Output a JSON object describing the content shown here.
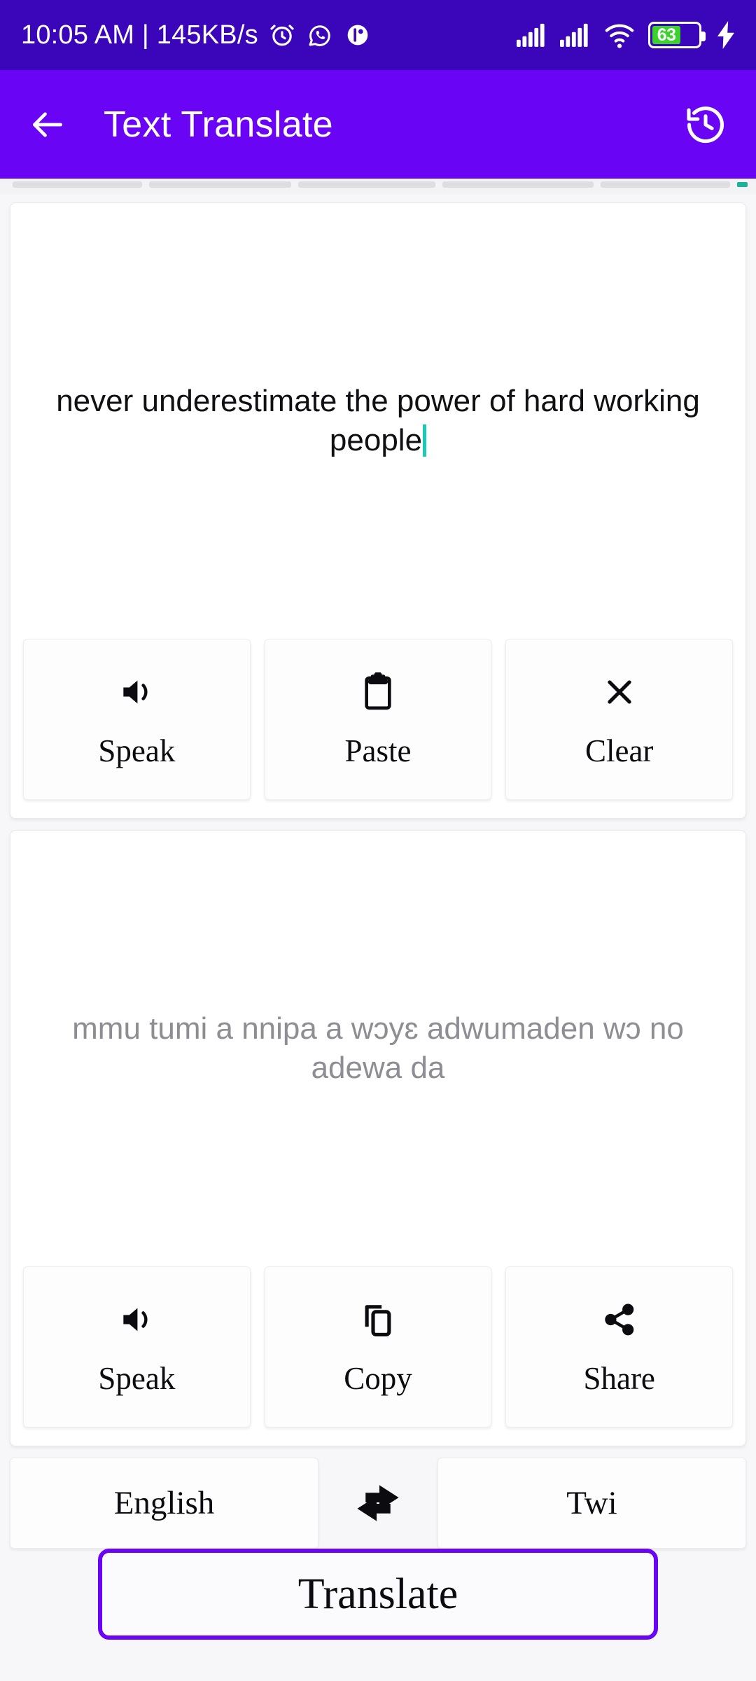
{
  "status_bar": {
    "time": "10:05 AM",
    "separator": "|",
    "network_speed": "145KB/s",
    "battery_level": "63",
    "icons_left": [
      "alarm-icon",
      "whatsapp-icon",
      "app-icon"
    ],
    "icons_right": [
      "signal-1-icon",
      "signal-2-icon",
      "wifi-icon",
      "battery-icon",
      "charging-bolt-icon"
    ],
    "background_color": "#3b06b9",
    "battery_fill_color": "#3ad22b"
  },
  "app_bar": {
    "back_icon": "arrow-left-icon",
    "title": "Text Translate",
    "history_icon": "history-clock-icon",
    "background_color": "#6a04f4"
  },
  "input_card": {
    "text": "never underestimate the power of hard working people",
    "caret_color": "#1ec8b4",
    "actions": [
      {
        "label": "Speak",
        "icon": "volume-speaker-icon"
      },
      {
        "label": "Paste",
        "icon": "clipboard-icon"
      },
      {
        "label": "Clear",
        "icon": "close-x-icon"
      }
    ]
  },
  "output_card": {
    "text": "mmu tumi a nnipa a wɔyɛ adwumaden wɔ no adewa da",
    "text_color": "#8d8d93",
    "actions": [
      {
        "label": "Speak",
        "icon": "volume-speaker-icon"
      },
      {
        "label": "Copy",
        "icon": "copy-icon"
      },
      {
        "label": "Share",
        "icon": "share-nodes-icon"
      }
    ]
  },
  "language_selector": {
    "source_language": "English",
    "swap_icon": "swap-horizontal-arrows-icon",
    "target_language": "Twi"
  },
  "translate_button": {
    "label": "Translate",
    "border_color": "#6a04f4"
  }
}
